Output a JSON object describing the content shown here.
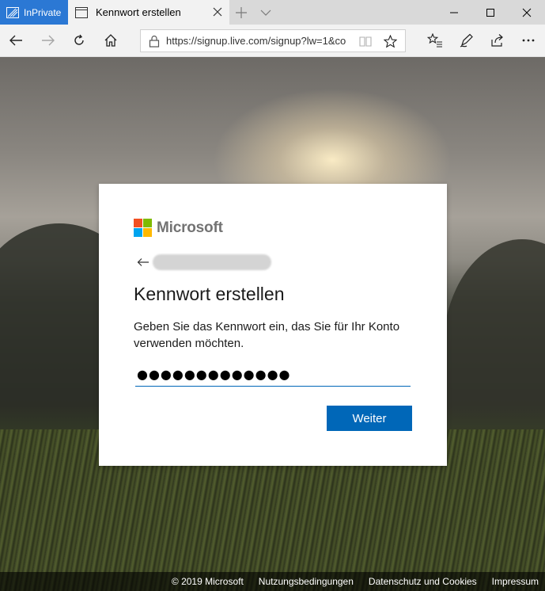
{
  "browser": {
    "inprivate_label": "InPrivate",
    "tab_title": "Kennwort erstellen",
    "url": "https://signup.live.com/signup?lw=1&co"
  },
  "icons": {
    "inprivate": "inprivate-icon",
    "tab": "tab-page-icon",
    "tab_close": "close-icon",
    "new_tab": "plus-icon",
    "tab_menu": "chevron-down-icon",
    "minimize": "minimize-icon",
    "maximize": "maximize-icon",
    "close": "close-icon",
    "back": "back-arrow-icon",
    "forward": "forward-arrow-icon",
    "refresh": "refresh-icon",
    "home": "home-icon",
    "lock": "lock-icon",
    "reading_view": "book-icon",
    "favorite": "star-icon",
    "favorites_hub": "favorites-list-icon",
    "notes": "pen-icon",
    "share": "share-icon",
    "more": "more-icon"
  },
  "colors": {
    "inprivate_blue": "#2b78d4",
    "ms_red": "#f25022",
    "ms_green": "#7fba00",
    "ms_blue": "#00a4ef",
    "ms_yellow": "#ffb900",
    "primary_button": "#0067b8"
  },
  "card": {
    "brand": "Microsoft",
    "title": "Kennwort erstellen",
    "description": "Geben Sie das Kennwort ein, das Sie für Ihr Konto verwenden möchten.",
    "password_value": "●●●●●●●●●●●●●",
    "next_label": "Weiter"
  },
  "footer": {
    "copyright": "© 2019 Microsoft",
    "terms": "Nutzungsbedingungen",
    "privacy": "Datenschutz und Cookies",
    "imprint": "Impressum"
  }
}
